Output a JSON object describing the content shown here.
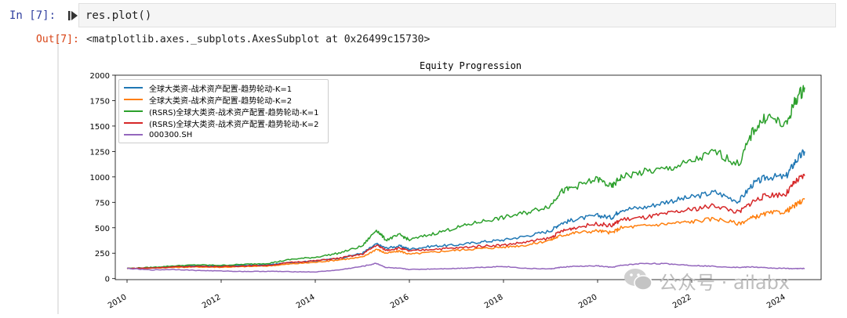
{
  "cell": {
    "in_prompt": "In  [7]:",
    "code": "res.plot()",
    "out_prompt": "Out[7]:",
    "output_text": "<matplotlib.axes._subplots.AxesSubplot at 0x26499c15730>"
  },
  "watermark": {
    "text": "公众号 · ailabx"
  },
  "chart_data": {
    "type": "line",
    "title": "Equity Progression",
    "xlabel": "",
    "ylabel": "",
    "ylim": [
      -10,
      2000
    ],
    "xlim": [
      2009.75,
      2024.75
    ],
    "grid": false,
    "legend_position": "top-left",
    "yticks": [
      0,
      250,
      500,
      750,
      1000,
      1250,
      1500,
      1750,
      2000
    ],
    "xticks": [
      "2010",
      "2012",
      "2014",
      "2016",
      "2018",
      "2020",
      "2022",
      "2024"
    ],
    "x": [
      2010.0,
      2010.5,
      2011.0,
      2011.5,
      2012.0,
      2012.5,
      2013.0,
      2013.5,
      2014.0,
      2014.5,
      2015.0,
      2015.3,
      2015.5,
      2015.8,
      2016.0,
      2016.5,
      2017.0,
      2017.5,
      2018.0,
      2018.5,
      2019.0,
      2019.2,
      2019.5,
      2020.0,
      2020.3,
      2020.5,
      2021.0,
      2021.5,
      2022.0,
      2022.5,
      2023.0,
      2023.3,
      2023.6,
      2024.0,
      2024.2,
      2024.4
    ],
    "series": [
      {
        "name": "全球大类资-战术资产配置-趋势轮动-K=1",
        "color": "#1f77b4",
        "values": [
          100,
          105,
          118,
          125,
          122,
          130,
          135,
          160,
          175,
          200,
          250,
          340,
          300,
          320,
          290,
          320,
          330,
          360,
          380,
          420,
          470,
          540,
          580,
          620,
          600,
          680,
          700,
          760,
          800,
          850,
          760,
          930,
          1000,
          1000,
          1150,
          1250
        ]
      },
      {
        "name": "全球大类资-战术资产配置-趋势轮动-K=2",
        "color": "#ff7f0e",
        "values": [
          100,
          103,
          110,
          115,
          112,
          118,
          125,
          145,
          160,
          185,
          210,
          290,
          250,
          270,
          240,
          260,
          280,
          295,
          310,
          330,
          380,
          420,
          450,
          470,
          450,
          500,
          520,
          540,
          560,
          590,
          540,
          600,
          640,
          660,
          720,
          780
        ]
      },
      {
        "name": "(RSRS)全球大类资-战术资产配置-趋势轮动-K=1",
        "color": "#2ca02c",
        "values": [
          100,
          110,
          125,
          135,
          130,
          140,
          150,
          190,
          210,
          250,
          320,
          480,
          380,
          430,
          380,
          440,
          500,
          560,
          600,
          650,
          720,
          850,
          900,
          980,
          900,
          1000,
          1050,
          1080,
          1150,
          1250,
          1120,
          1450,
          1600,
          1500,
          1750,
          1880
        ]
      },
      {
        "name": "(RSRS)全球大类资-战术资产配置-趋势轮动-K=2",
        "color": "#d62728",
        "values": [
          100,
          104,
          115,
          120,
          118,
          125,
          130,
          160,
          175,
          200,
          240,
          330,
          280,
          300,
          270,
          290,
          300,
          320,
          330,
          360,
          400,
          460,
          500,
          540,
          520,
          580,
          600,
          640,
          680,
          720,
          650,
          760,
          820,
          830,
          950,
          1010
        ]
      },
      {
        "name": "000300.SH",
        "color": "#9467bd",
        "values": [
          100,
          85,
          90,
          80,
          75,
          70,
          72,
          68,
          65,
          85,
          120,
          150,
          110,
          100,
          90,
          95,
          100,
          110,
          120,
          100,
          95,
          110,
          120,
          125,
          110,
          130,
          150,
          145,
          130,
          120,
          110,
          115,
          105,
          100,
          98,
          100
        ]
      }
    ]
  }
}
